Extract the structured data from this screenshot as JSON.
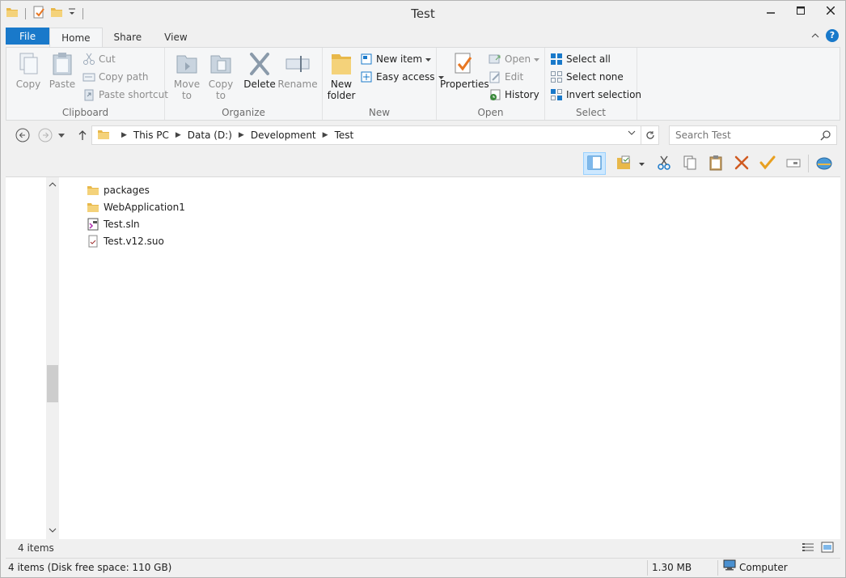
{
  "window": {
    "title": "Test"
  },
  "ribbon_tabs": {
    "file": "File",
    "home": "Home",
    "share": "Share",
    "view": "View"
  },
  "clipboard": {
    "copy": "Copy",
    "paste": "Paste",
    "cut": "Cut",
    "copy_path": "Copy path",
    "paste_shortcut": "Paste shortcut",
    "label": "Clipboard"
  },
  "organize": {
    "move_to_1": "Move",
    "move_to_2": "to",
    "copy_to_1": "Copy",
    "copy_to_2": "to",
    "delete": "Delete",
    "rename": "Rename",
    "label": "Organize"
  },
  "new_group": {
    "new_folder_1": "New",
    "new_folder_2": "folder",
    "new_item": "New item",
    "easy_access": "Easy access",
    "label": "New"
  },
  "open_group": {
    "properties": "Properties",
    "open": "Open",
    "edit": "Edit",
    "history": "History",
    "label": "Open"
  },
  "select_group": {
    "select_all": "Select all",
    "select_none": "Select none",
    "invert_selection": "Invert selection",
    "label": "Select"
  },
  "address": {
    "crumbs": [
      "This PC",
      "Data (D:)",
      "Development",
      "Test"
    ]
  },
  "search": {
    "placeholder": "Search Test"
  },
  "files": [
    {
      "name": "packages",
      "icon": "folder-icon"
    },
    {
      "name": "WebApplication1",
      "icon": "folder-icon"
    },
    {
      "name": "Test.sln",
      "icon": "solution-file-icon"
    },
    {
      "name": "Test.v12.suo",
      "icon": "suo-file-icon"
    }
  ],
  "info": {
    "item_count": "4 items"
  },
  "status": {
    "items_disk": "4 items (Disk free space: 110 GB)",
    "size": "1.30 MB",
    "location": "Computer"
  },
  "colors": {
    "accent": "#1979ca",
    "folder": "#e8b84a"
  }
}
